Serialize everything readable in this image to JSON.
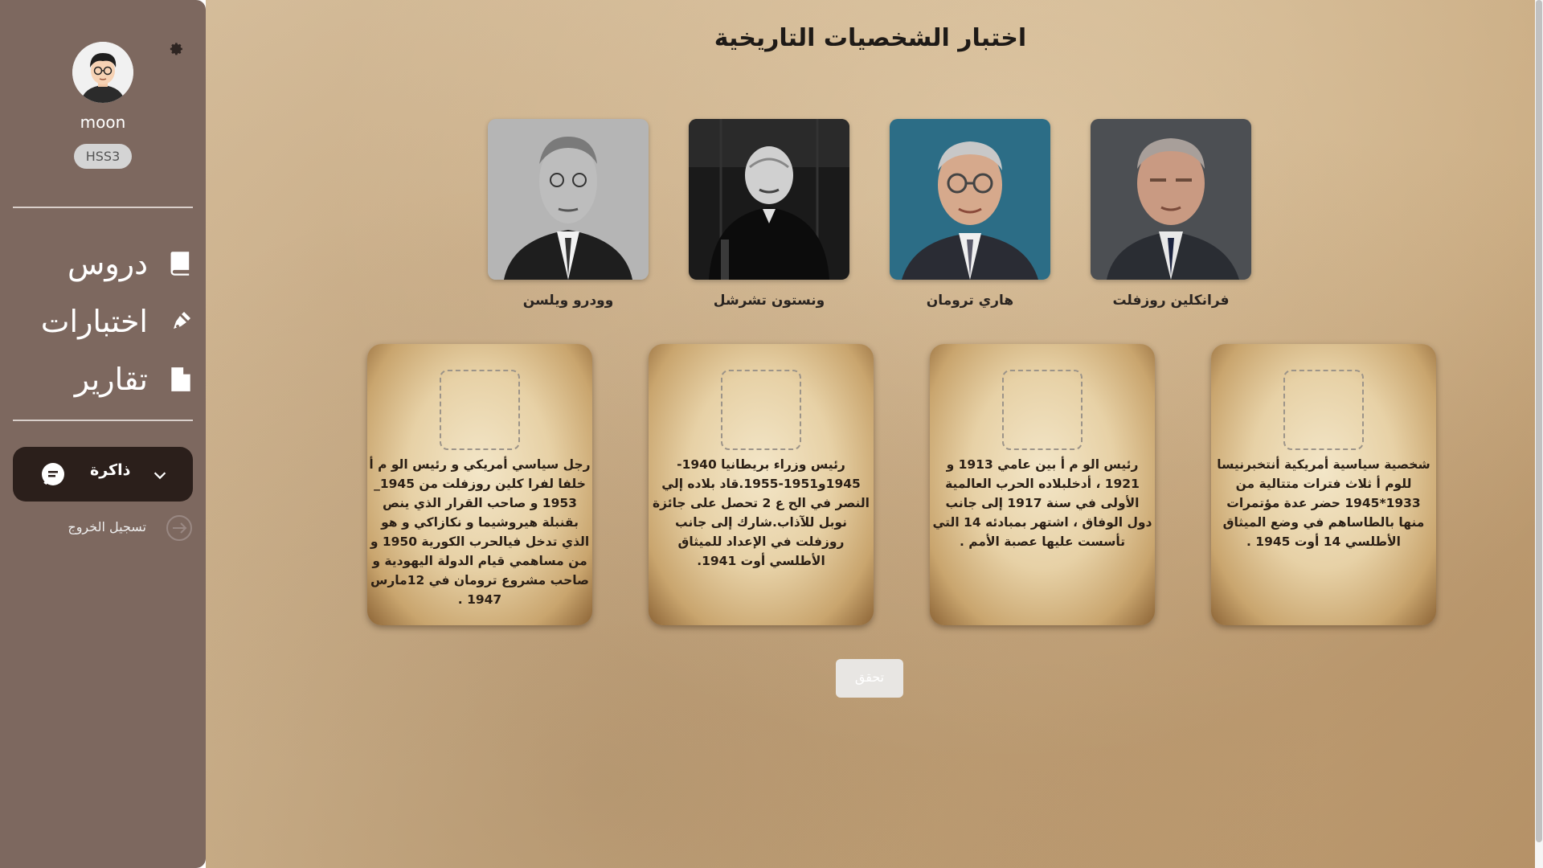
{
  "sidebar": {
    "username": "moon",
    "class_badge": "HSS3",
    "nav": [
      {
        "label": "دروس",
        "icon": "book-icon"
      },
      {
        "label": "اختبارات",
        "icon": "pen-icon"
      },
      {
        "label": "تقارير",
        "icon": "file-icon"
      }
    ],
    "memory_label": "ذاكرة",
    "logout_label": "تسجيل الخروج"
  },
  "main": {
    "title": "اختبار الشخصيات التاريخية",
    "portraits": [
      {
        "name": "فرانكلين روزفلت"
      },
      {
        "name": "هاري ترومان"
      },
      {
        "name": "ونستون تشرشل"
      },
      {
        "name": "وودرو ويلسن"
      }
    ],
    "cards": [
      {
        "text": "شخصية سياسية أمريكية أنتخبرنيسا للوم أ ثلاث فترات متتالية من 1933*1945 حضر عدة مؤتمرات منها بالطاساهم في وضع الميثاق الأطلسي 14 أوت 1945 ."
      },
      {
        "text": "رئيس الو م أ بين عامي 1913 و 1921 ، أدخلبلاده الحرب العالمية الأولى في سنة 1917 إلى جانب دول الوفاق ، اشتهر بمبادئه 14 التي تأسست عليها عصبة الأمم ."
      },
      {
        "text": "رئيس وزراء بريطانيا 1940-1945و1951-1955.قاد بلاده إلي النصر في الح ع 2 تحصل على جائزة نوبل للآذاب.شارك إلى جانب روزفلت في الإعداد للميثاق الأطلسي أوت 1941."
      },
      {
        "text": "رجل سياسي أمريكي و رئيس الو م أ خلفا لفرا كلين روزفلت من 1945_ 1953 و صاحب القرار الذي ينص بقنبلة هيروشيما و نكازاكي و هو الذي تدخل فيالحرب الكورية 1950 و من مساهمي قيام الدولة اليهودية و صاحب مشروع ترومان في 12مارس 1947 ."
      }
    ],
    "check_button": "تحقق"
  },
  "colors": {
    "sidebar_bg": "#7d685f",
    "memory_button_bg": "#2b1f1b",
    "chat_icon_bg": "#ffffff"
  }
}
